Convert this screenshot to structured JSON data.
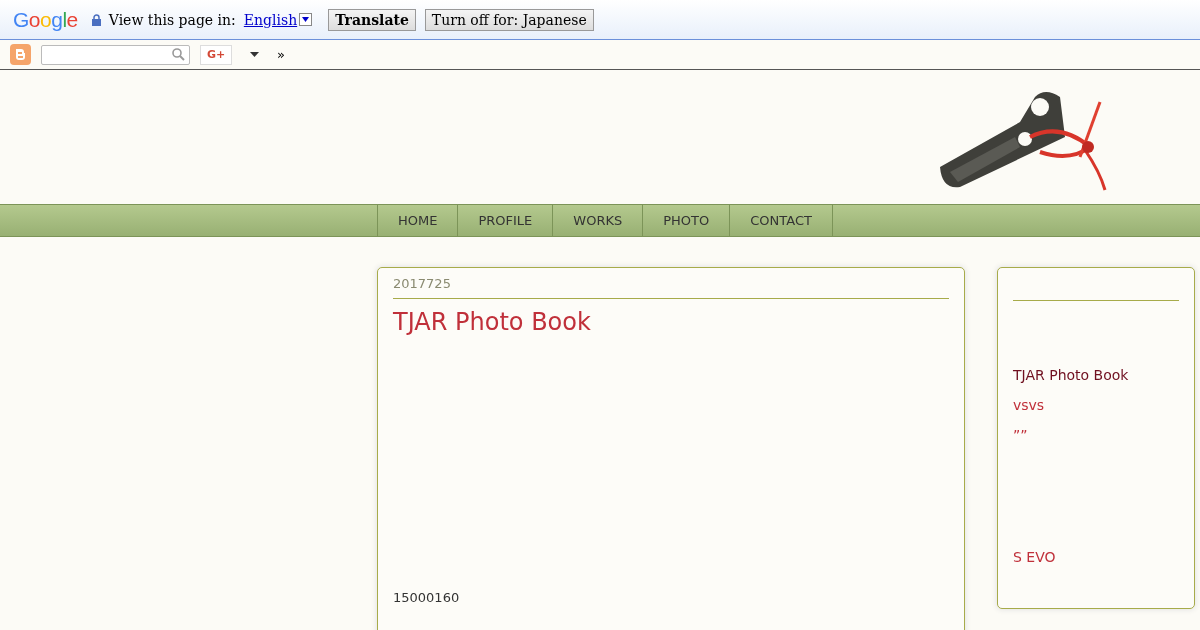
{
  "translate_bar": {
    "logo": "Google",
    "prompt": "View this page in:",
    "language": "English",
    "buttons": [
      "Translate",
      "Turn off for: Japanese"
    ]
  },
  "blogger_bar": {
    "share": "G+",
    "more": "»"
  },
  "nav": [
    {
      "label": "HOME"
    },
    {
      "label": "PROFILE"
    },
    {
      "label": "WORKS"
    },
    {
      "label": "PHOTO"
    },
    {
      "label": "CONTACT"
    }
  ],
  "post": {
    "date": "2017725",
    "title": "TJAR Photo Book",
    "body": "15000160"
  },
  "sidebar": {
    "links": [
      {
        "text": "TJAR Photo Book",
        "kind": "title"
      },
      {
        "text": "vsvs",
        "kind": "link"
      },
      {
        "text": "””",
        "kind": "link"
      },
      {
        "text": "S EVO",
        "kind": "link"
      }
    ]
  }
}
